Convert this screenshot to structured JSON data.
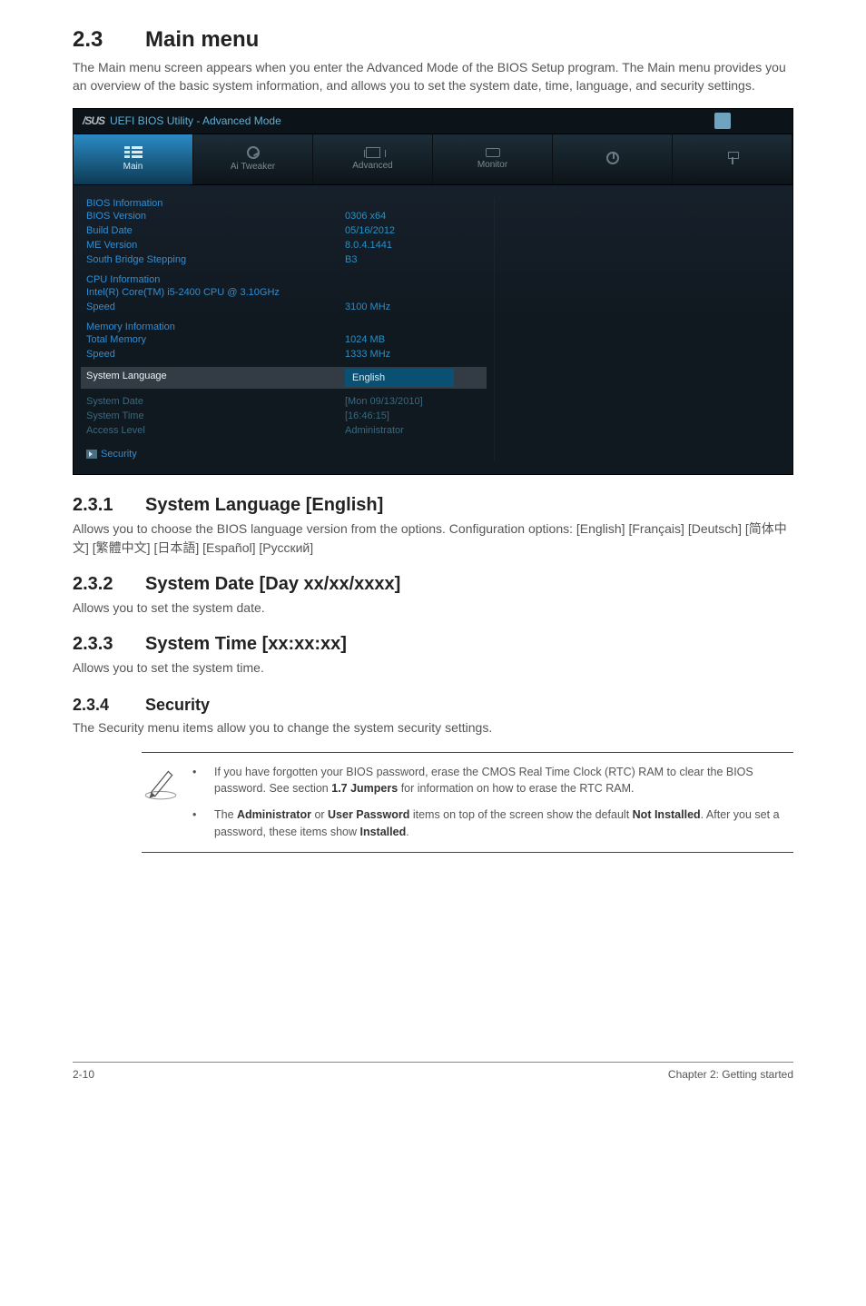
{
  "page": {
    "section_number": "2.3",
    "section_title": "Main menu",
    "intro": "The Main menu screen appears when you enter the Advanced Mode of the BIOS Setup program. The Main menu provides you an overview of the basic system information, and allows you to set the system date, time, language, and security settings."
  },
  "bios": {
    "header_logo": "/SUS",
    "header_title": "UEFI BIOS Utility - Advanced Mode",
    "tabs": [
      "Main",
      "Ai Tweaker",
      "Advanced",
      "Monitor",
      "",
      ""
    ],
    "active_tab_index": 0,
    "groups": [
      {
        "title": "BIOS Information",
        "rows": [
          {
            "label": "BIOS Version",
            "value": "0306 x64"
          },
          {
            "label": "Build Date",
            "value": "05/16/2012"
          },
          {
            "label": "ME Version",
            "value": "8.0.4.1441"
          },
          {
            "label": "South Bridge Stepping",
            "value": "B3"
          }
        ]
      },
      {
        "title": "CPU Information",
        "subtitle": "Intel(R) Core(TM) i5-2400 CPU @ 3.10GHz",
        "rows": [
          {
            "label": "Speed",
            "value": "3100 MHz"
          }
        ]
      },
      {
        "title": "Memory Information",
        "rows": [
          {
            "label": "Total Memory",
            "value": "1024 MB"
          },
          {
            "label": "Speed",
            "value": "1333 MHz"
          }
        ]
      }
    ],
    "system_language_label": "System Language",
    "system_language_value": "English",
    "footer_rows": [
      {
        "label": "System Date",
        "value": "[Mon 09/13/2010]"
      },
      {
        "label": "System Time",
        "value": "[16:46:15]"
      },
      {
        "label": "Access Level",
        "value": "Administrator"
      }
    ],
    "security_label": "Security"
  },
  "subsections": {
    "s1": {
      "num": "2.3.1",
      "title": "System Language [English]",
      "body": "Allows you to choose the BIOS language version from the options. Configuration options: [English] [Français] [Deutsch] [简体中文] [繁體中文] [日本語] [Español] [Русский]"
    },
    "s2": {
      "num": "2.3.2",
      "title": "System Date [Day xx/xx/xxxx]",
      "body": "Allows you to set the system date."
    },
    "s3": {
      "num": "2.3.3",
      "title": "System Time [xx:xx:xx]",
      "body": "Allows you to set the system time."
    },
    "s4": {
      "num": "2.3.4",
      "title": "Security",
      "body": "The Security menu items allow you to change the system security settings."
    }
  },
  "note": {
    "items": [
      "If you have forgotten your BIOS password, erase the CMOS Real Time Clock (RTC) RAM to clear the BIOS password. See section <b>1.7 Jumpers</b> for information on how to erase the RTC RAM.",
      "The <b>Administrator</b> or <b>User Password</b> items on top of the screen show the default <b>Not Installed</b>. After you set a password, these items show <b>Installed</b>."
    ]
  },
  "footer": {
    "page_num": "2-10",
    "chapter": "Chapter 2: Getting started"
  }
}
